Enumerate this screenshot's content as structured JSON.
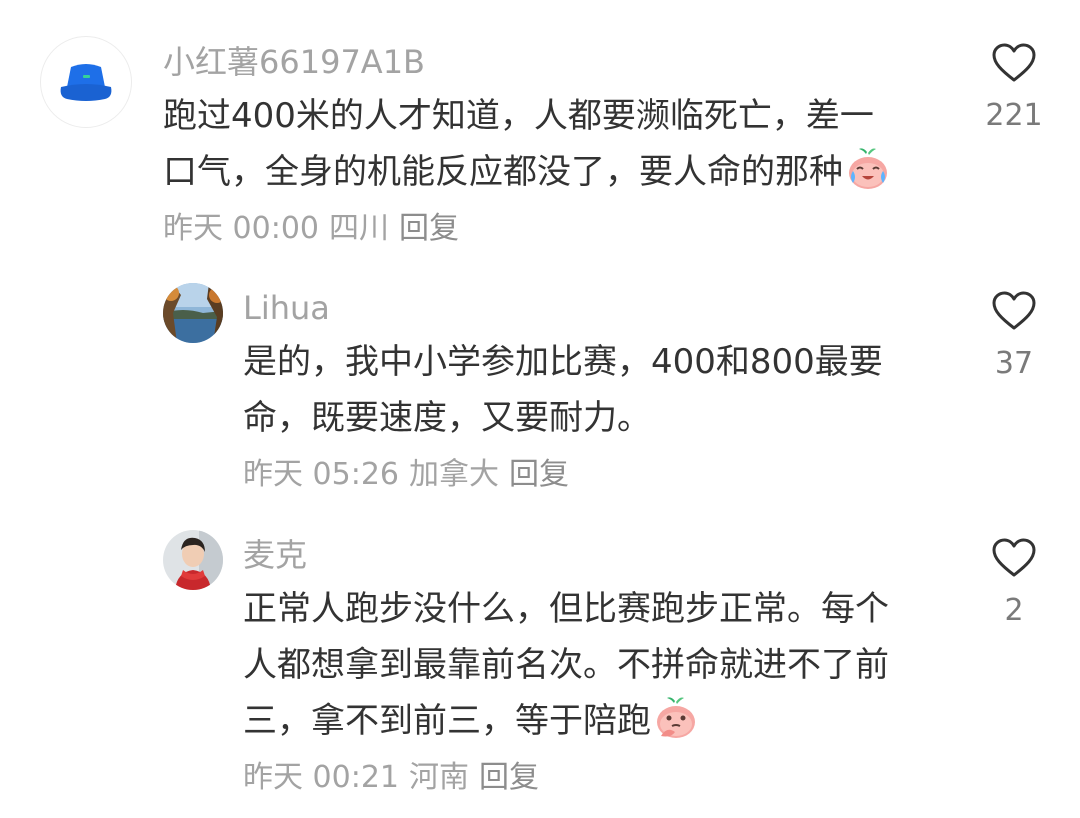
{
  "comments": [
    {
      "username": "小红薯66197A1B",
      "lines": [
        "跑过400米的人才知道，人都要濒临死亡，差一",
        "口气，全身的机能反应都没了，要人命的那种"
      ],
      "emoji": "crying-laughing-peach-emoji",
      "time": "昨天 00:00",
      "location": "四川",
      "reply_label": "回复",
      "likes": "221",
      "avatar_icon": "blue-bucket-hat-icon"
    },
    {
      "username": "Lihua",
      "lines": [
        "是的，我中小学参加比赛，400和800最要",
        "命，既要速度，又要耐力。"
      ],
      "time": "昨天 05:26",
      "location": "加拿大",
      "reply_label": "回复",
      "likes": "37",
      "avatar_icon": "lake-landscape-photo"
    },
    {
      "username": "麦克",
      "lines": [
        "正常人跑步没什么，但比赛跑步正常。每个",
        "人都想拿到最靠前名次。不拼命就进不了前",
        "三，拿不到前三，等于陪跑"
      ],
      "emoji": "thinking-peach-emoji",
      "time": "昨天 00:21",
      "location": "河南",
      "reply_label": "回复",
      "likes": "2",
      "avatar_icon": "person-red-scarf-photo"
    }
  ],
  "colors": {
    "text": "#333333",
    "secondary": "#a3a3a3",
    "hat_blue": "#1e6fe8"
  }
}
